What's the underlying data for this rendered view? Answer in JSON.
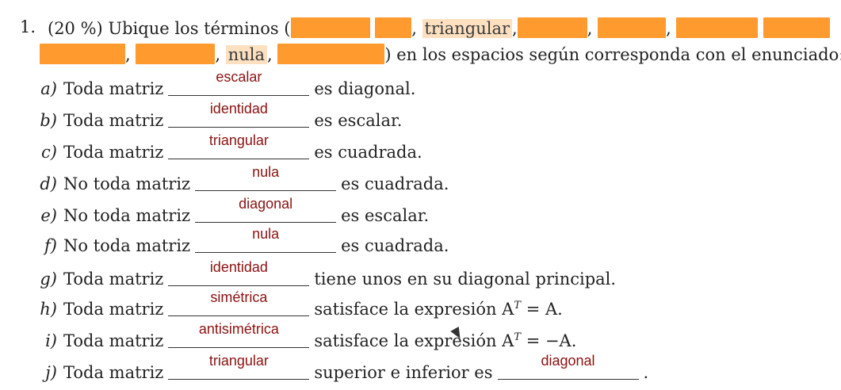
{
  "question": {
    "number": "1.",
    "prefix": "(20 %) Ubique los términos (",
    "terms_visible": [
      "triangular",
      "nula"
    ],
    "suffix": ") en los espacios según corresponda con el enunciado:"
  },
  "items": [
    {
      "label": "a)",
      "lead": "Toda matriz",
      "answer": "escalar",
      "tail": "es diagonal."
    },
    {
      "label": "b)",
      "lead": "Toda matriz",
      "answer": "identidad",
      "tail": "es escalar."
    },
    {
      "label": "c)",
      "lead": "Toda matriz",
      "answer": "triangular",
      "tail": "es cuadrada."
    },
    {
      "label": "d)",
      "lead": "No toda matriz",
      "answer": "nula",
      "tail": "es cuadrada."
    },
    {
      "label": "e)",
      "lead": "No toda matriz",
      "answer": "diagonal",
      "tail": "es escalar."
    },
    {
      "label": "f)",
      "lead": "No toda matriz",
      "answer": "nula",
      "tail": "es cuadrada."
    },
    {
      "label": "g)",
      "lead": "Toda matriz",
      "answer": "identidad",
      "tail": "tiene unos en su diagonal principal."
    },
    {
      "label": "h)",
      "lead": "Toda matriz",
      "answer": "simétrica",
      "tail": "satisface la expresión A",
      "sup": "T",
      "eq": " = A."
    },
    {
      "label": "i)",
      "lead": "Toda matriz",
      "answer": "antisimétrica",
      "tail": "satisface la expresión A",
      "sup": "T",
      "eq": " = −A."
    },
    {
      "label": "j)",
      "lead": "Toda matriz",
      "answer": "triangular",
      "tail": "superior e inferior es",
      "answer2": "diagonal",
      "end": "."
    }
  ],
  "colors": {
    "answer": "#8a1212",
    "redaction": "#ff9a2e",
    "highlight": "#fde0c0"
  }
}
